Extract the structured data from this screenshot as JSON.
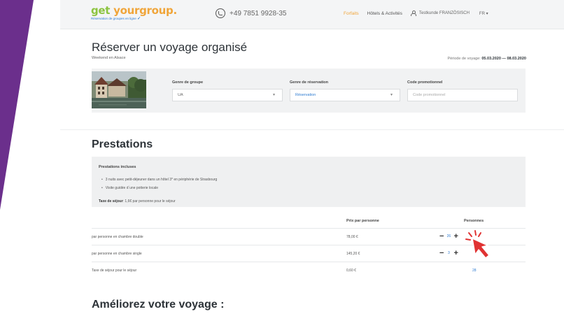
{
  "colors": {
    "brand_green": "#8cc43f",
    "brand_orange": "#f0a53a",
    "accent_blue": "#2e7bd1",
    "slide_purple": "#6b2f8c",
    "cursor_red": "#e03232"
  },
  "header": {
    "logo_prefix": "get ",
    "logo_o": "y",
    "logo_mid": "o",
    "logo_suffix": "urgroup.",
    "logo_tagline": "Réservation de groupes en ligne",
    "phone": "+49 7851 9928-35",
    "nav": {
      "forfaits": "Forfaits",
      "hotels": "Hôtels & Activités"
    },
    "user_name": "Testkunde FRANZÖSISCH",
    "language": "FR ▾"
  },
  "page": {
    "title": "Réserver un voyage organisé",
    "subtitle": "Weekend en Alsace",
    "period_label": "Période de voyage:",
    "period_value": "05.03.2020 — 08.03.2020"
  },
  "form": {
    "genre_groupe_label": "Genre de groupe",
    "genre_groupe_value": "UA",
    "genre_reservation_label": "Genre de réservation",
    "genre_reservation_value": "Réservation",
    "code_promo_label": "Code promotionnel",
    "code_promo_placeholder": "Code promotionnel"
  },
  "prestations": {
    "section_title": "Prestations",
    "included_heading": "Prestations incluses",
    "items": [
      "3 nuits avec petit-déjeuner dans un hôtel 3* en périphérie de Strasbourg",
      "Visite guidée d´une potterie locale"
    ],
    "taxe_label": "Taxe de séjour",
    "taxe_text": ": 1,6€ par personne pour le séjour"
  },
  "table": {
    "headers": {
      "price": "Prix par personne",
      "persons": "Personnes"
    },
    "rows": [
      {
        "label": "par personne en chambre double",
        "price": "78,00 €",
        "qty": "26"
      },
      {
        "label": "par personne en chambre single",
        "price": "145,20 €",
        "qty": "3"
      },
      {
        "label": "Taxe de séjour pour le séjour",
        "price": "0,60 €",
        "qty": "28"
      }
    ]
  },
  "upgrade": {
    "title": "Améliorez votre voyage :"
  }
}
